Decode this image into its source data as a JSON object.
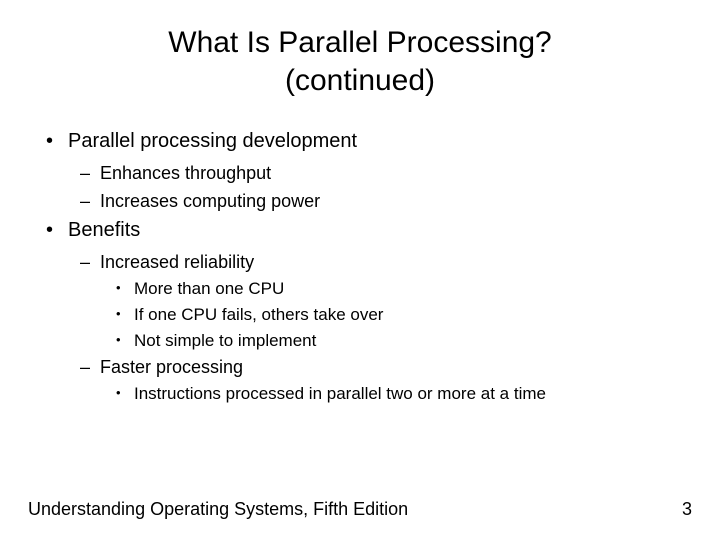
{
  "title_line1": "What Is Parallel Processing?",
  "title_line2": "(continued)",
  "items": {
    "i0": "Parallel processing development",
    "i0_0": "Enhances throughput",
    "i0_1": "Increases computing power",
    "i1": "Benefits",
    "i1_0": "Increased reliability",
    "i1_0_0": "More than one CPU",
    "i1_0_1": "If one CPU fails, others take over",
    "i1_0_2": "Not simple to implement",
    "i1_1": "Faster processing",
    "i1_1_0": "Instructions processed in parallel two or more at a time"
  },
  "footer": {
    "book": "Understanding Operating Systems, Fifth Edition",
    "page": "3"
  }
}
